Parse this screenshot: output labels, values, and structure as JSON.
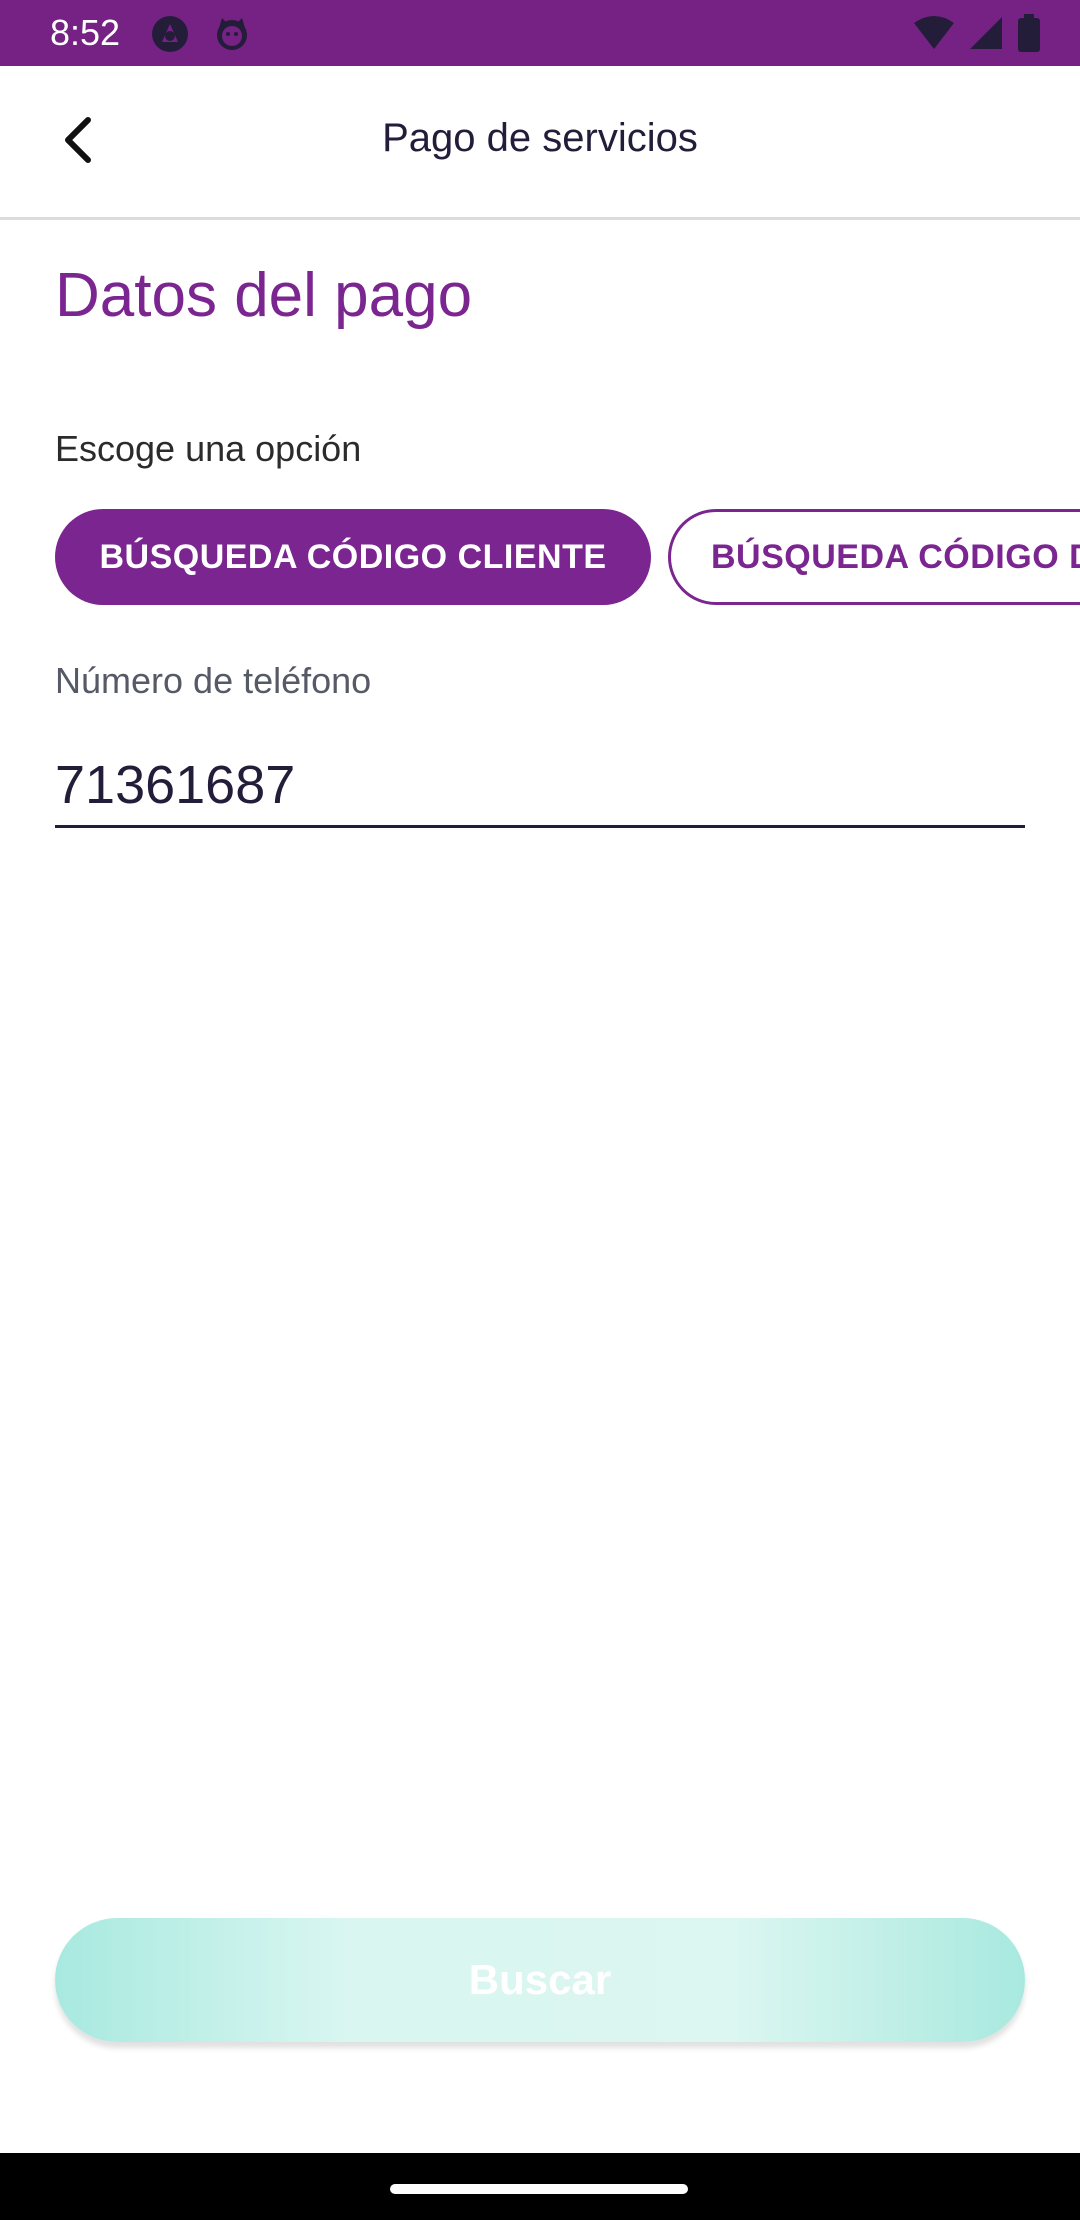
{
  "status_bar": {
    "time": "8:52",
    "icons": [
      "app-notification-icon",
      "cat-face-icon",
      "wifi-icon",
      "signal-icon",
      "battery-icon"
    ],
    "background": "#752284"
  },
  "app_bar": {
    "title": "Pago de servicios",
    "back_icon": "chevron-left-icon"
  },
  "main": {
    "section_title": "Datos del pago",
    "option_label": "Escoge una opción",
    "options": [
      {
        "label": "BÚSQUEDA CÓDIGO CLIENTE",
        "selected": true
      },
      {
        "label": "BÚSQUEDA CÓDIGO D",
        "selected": false
      }
    ],
    "phone_field": {
      "label": "Número de teléfono",
      "value": "71361687"
    },
    "search_button": {
      "label": "Buscar"
    }
  },
  "colors": {
    "primary": "#7B2590",
    "accent": "#A8E9DF",
    "text_dark": "#231D3A"
  }
}
